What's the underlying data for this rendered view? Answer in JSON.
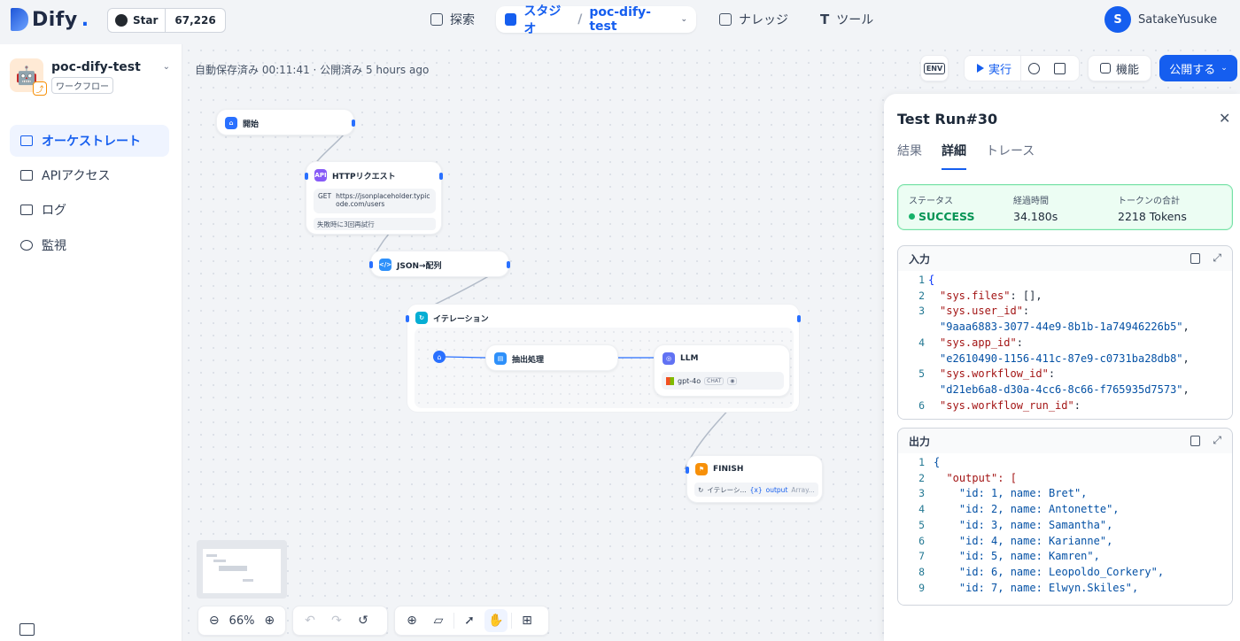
{
  "brand": {
    "logo_text": "Dify",
    "logo_dot": ".",
    "github_star_label": "Star",
    "github_star_count": "67,226"
  },
  "nav": {
    "explore": "探索",
    "studio": "スタジオ",
    "app_name": "poc-dify-test",
    "knowledge": "ナレッジ",
    "tools": "ツール"
  },
  "user": {
    "initial": "S",
    "name": "SatakeYusuke"
  },
  "sidebar": {
    "app_name": "poc-dify-test",
    "app_type": "ワークフロー",
    "items": [
      {
        "label": "オーケストレート",
        "active": true
      },
      {
        "label": "APIアクセス",
        "active": false
      },
      {
        "label": "ログ",
        "active": false
      },
      {
        "label": "監視",
        "active": false
      }
    ]
  },
  "canvas": {
    "autosave": "自動保存済み 00:11:41 · 公開済み 5 hours ago",
    "env_label": "ENV",
    "run_label": "実行",
    "features_label": "機能",
    "publish_label": "公開する",
    "zoom": "66%"
  },
  "nodes": {
    "start": {
      "title": "開始"
    },
    "http": {
      "title": "HTTPリクエスト",
      "method": "GET",
      "url": "https://jsonplaceholder.typicode.com/users",
      "retry": "失敗時に3回再試行"
    },
    "json": {
      "title": "JSON→配列"
    },
    "iteration": {
      "title": "イテレーション"
    },
    "extract": {
      "title": "抽出処理"
    },
    "llm": {
      "title": "LLM",
      "model": "gpt-4o",
      "mode": "CHAT"
    },
    "finish": {
      "title": "FINISH",
      "var_source": "イテレーシ...",
      "var_name": "output",
      "var_type": "Array..."
    }
  },
  "panel": {
    "title": "Test Run#30",
    "tabs": [
      "結果",
      "詳細",
      "トレース"
    ],
    "active_tab": "詳細",
    "status_label": "ステータス",
    "status_value": "SUCCESS",
    "elapsed_label": "経過時間",
    "elapsed_value": "34.180s",
    "tokens_label": "トークンの合計",
    "tokens_value": "2218 Tokens",
    "input_label": "入力",
    "output_label": "出力"
  },
  "input_lines": [
    {
      "n": "1",
      "text": "{"
    },
    {
      "n": "2",
      "key": "\"sys.files\"",
      "rest": ": [],"
    },
    {
      "n": "3",
      "key": "\"sys.user_id\"",
      "rest": ":"
    },
    {
      "n": "",
      "val": "\"9aaa6883-3077-44e9-8b1b-1a74946226b5\"",
      "rest": ","
    },
    {
      "n": "4",
      "key": "\"sys.app_id\"",
      "rest": ":"
    },
    {
      "n": "",
      "val": "\"e2610490-1156-411c-87e9-c0731ba28db8\"",
      "rest": ","
    },
    {
      "n": "5",
      "key": "\"sys.workflow_id\"",
      "rest": ":"
    },
    {
      "n": "",
      "val": "\"d21eb6a8-d30a-4cc6-8c66-f765935d7573\"",
      "rest": ","
    },
    {
      "n": "6",
      "key": "\"sys.workflow_run_id\"",
      "rest": ":"
    }
  ],
  "output_lines": [
    {
      "n": "1",
      "text": "{"
    },
    {
      "n": "2",
      "text": "  \"output\": ["
    },
    {
      "n": "3",
      "text": "    \"id: 1, name: Bret\","
    },
    {
      "n": "4",
      "text": "    \"id: 2, name: Antonette\","
    },
    {
      "n": "5",
      "text": "    \"id: 3, name: Samantha\","
    },
    {
      "n": "6",
      "text": "    \"id: 4, name: Karianne\","
    },
    {
      "n": "7",
      "text": "    \"id: 5, name: Kamren\","
    },
    {
      "n": "8",
      "text": "    \"id: 6, name: Leopoldo_Corkery\","
    },
    {
      "n": "9",
      "text": "    \"id: 7, name: Elwyn.Skiles\","
    }
  ],
  "colors": {
    "accent": "#155eef",
    "success": "#17b26a",
    "http": "#875bf7",
    "json": "#2e90fa",
    "iteration": "#06aed4",
    "llm": "#6172f3",
    "finish": "#f79009"
  }
}
